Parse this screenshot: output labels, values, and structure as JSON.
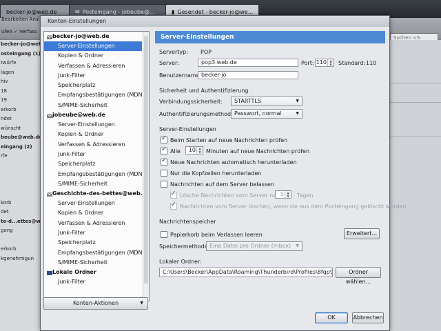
{
  "background": {
    "tabs": [
      {
        "label": "Posteingang - jobeube@..."
      },
      {
        "label": "Gesendet - becker-jo@we..."
      }
    ],
    "first_tab_label": "becker-jo@web.de",
    "menu": "Bearbeiten  Ansicht",
    "toolbar_left": "ufen  ✓ Verfass",
    "search_placeholder": "Suchen <S",
    "folders": [
      {
        "label": "becker-jo@web.de",
        "bold": true
      },
      {
        "label": "osteingang (1)",
        "bold": true
      },
      {
        "label": "twürfe",
        "bold": false
      },
      {
        "label": "lagen",
        "bold": false
      },
      {
        "label": "hiv",
        "bold": false
      },
      {
        "label": "18",
        "bold": false
      },
      {
        "label": "19",
        "bold": false
      },
      {
        "label": "erkorb",
        "bold": false
      },
      {
        "label": "ndet",
        "bold": false
      },
      {
        "label": "wünscht",
        "bold": false
      },
      {
        "label": "beube@web.de",
        "bold": true
      },
      {
        "label": "eingang (2)",
        "bold": true
      },
      {
        "label": "rfe",
        "bold": false
      },
      {
        "label": "",
        "bold": false
      },
      {
        "label": "",
        "bold": false
      },
      {
        "label": "",
        "bold": false
      },
      {
        "label": "",
        "bold": false
      },
      {
        "label": "korb",
        "bold": false
      },
      {
        "label": "det",
        "bold": false
      },
      {
        "label": "te-d...ettes@web.",
        "bold": true
      },
      {
        "label": "gang",
        "bold": false
      },
      {
        "label": "",
        "bold": false
      },
      {
        "label": "erkorb",
        "bold": false
      },
      {
        "label": "kgenehmigun",
        "bold": false
      }
    ]
  },
  "dialog": {
    "title": "Konten-Einstellungen",
    "accounts": [
      {
        "name": "becker-jo@web.de",
        "items": [
          "Server-Einstellungen",
          "Kopien & Ordner",
          "Verfassen & Adressieren",
          "Junk-Filter",
          "Speicherplatz",
          "Empfangsbestätigungen (MDN)",
          "S/MIME-Sicherheit"
        ]
      },
      {
        "name": "jobeube@web.de",
        "items": [
          "Server-Einstellungen",
          "Kopien & Ordner",
          "Verfassen & Adressieren",
          "Junk-Filter",
          "Speicherplatz",
          "Empfangsbestätigungen (MDN)",
          "S/MIME-Sicherheit"
        ]
      },
      {
        "name": "Geschichte-des-bettes@web...",
        "items": [
          "Server-Einstellungen",
          "Kopien & Ordner",
          "Verfassen & Adressieren",
          "Junk-Filter",
          "Speicherplatz",
          "Empfangsbestätigungen (MDN)",
          "S/MIME-Sicherheit"
        ]
      },
      {
        "name": "Lokale Ordner",
        "items": [
          "Junk-Filter"
        ]
      }
    ],
    "selected_item": "Server-Einstellungen",
    "account_actions_label": "Konten-Aktionen",
    "panel": {
      "header": "Server-Einstellungen",
      "server_type_label": "Servertyp:",
      "server_type_value": "POP",
      "server_label": "Server:",
      "server_value": "pop3.web.de",
      "port_label": "Port:",
      "port_value": "110",
      "standard_label": "Standard:",
      "standard_value": "110",
      "username_label": "Benutzername:",
      "username_value": "becker-jo",
      "security_section": "Sicherheit und Authentifizierung",
      "conn_security_label": "Verbindungssicherheit:",
      "conn_security_value": "STARTTLS",
      "auth_method_label": "Authentifizierungsmethode:",
      "auth_method_value": "Passwort, normal",
      "server_settings_section": "Server-Einstellungen",
      "check_on_start": {
        "label": "Beim Starten auf neue Nachrichten prüfen",
        "checked": true
      },
      "check_every": {
        "label": "Alle",
        "checked": true,
        "minutes": "10",
        "suffix": "Minuten auf neue Nachrichten prüfen"
      },
      "auto_download": {
        "label": "Neue Nachrichten automatisch herunterladen",
        "checked": true
      },
      "headers_only": {
        "label": "Nur die Kopfzeilen herunterladen",
        "checked": false
      },
      "leave_on_server": {
        "label": "Nachrichten auf dem Server belassen",
        "checked": false
      },
      "delete_after": {
        "label": "Lösche Nachrichten vom Server nach",
        "checked": true,
        "days": "5",
        "suffix": "Tagen"
      },
      "delete_when_deleted": {
        "label": "Nachrichten vom Server löschen, wenn sie aus dem Posteingang gelöscht wurden",
        "checked": true
      },
      "storage_section": "Nachrichtenspeicher",
      "empty_trash": {
        "label": "Papierkorb beim Verlassen leeren",
        "checked": false
      },
      "advanced_button": "Erweitert...",
      "storage_method_label": "Speichermethode:",
      "storage_method_value": "Eine Datei pro Ordner (mbox)",
      "local_dir_label": "Lokaler Ordner:",
      "local_dir_value": "C:\\Users\\Becker\\AppData\\Roaming\\Thunderbird\\Profiles\\8fqp9as6.u",
      "choose_folder_button": "Ordner wählen...",
      "ok_button": "OK",
      "cancel_button": "Abbrechen"
    }
  }
}
